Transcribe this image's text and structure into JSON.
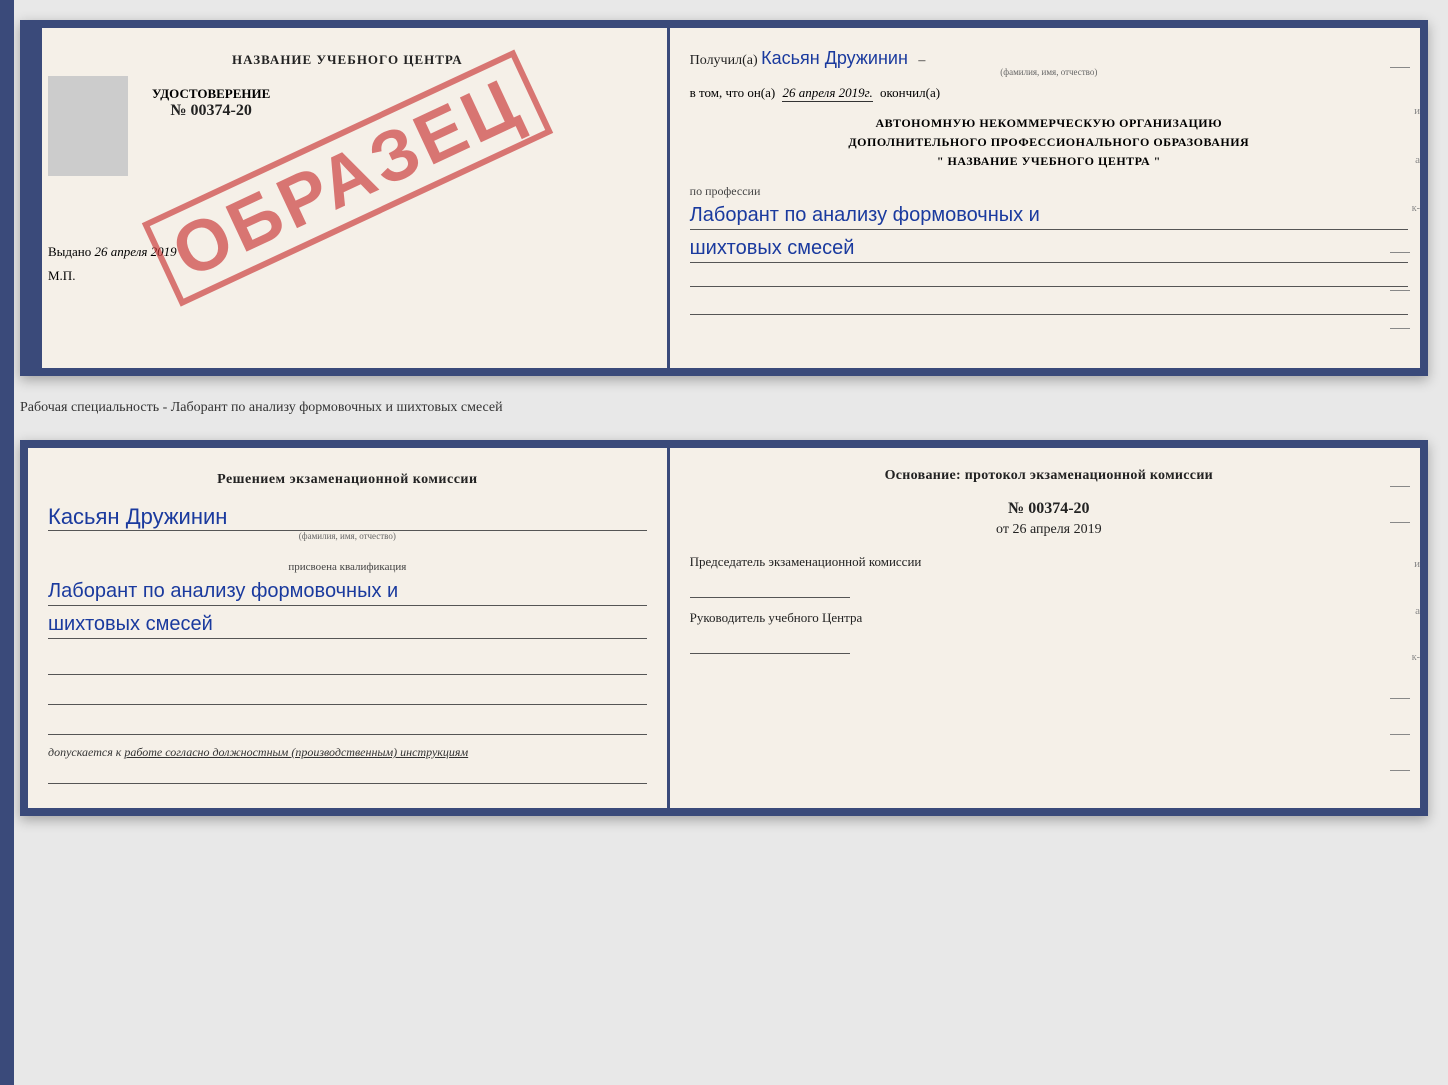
{
  "upper_cert": {
    "left": {
      "title": "НАЗВАНИЕ УЧЕБНОГО ЦЕНТРА",
      "doc_label": "УДОСТОВЕРЕНИЕ",
      "doc_number": "№ 00374-20",
      "vydano_label": "Выдано",
      "vydano_date": "26 апреля 2019",
      "mp_label": "М.П.",
      "obrazec": "ОБРАЗЕЦ"
    },
    "right": {
      "poluchil_prefix": "Получил(а)",
      "recipient_name": "Касьян Дружинин",
      "fio_subtitle": "(фамилия, имя, отчество)",
      "vtom_prefix": "в том, что он(а)",
      "completion_date": "26 апреля 2019г.",
      "okonchil": "окончил(а)",
      "org_line1": "АВТОНОМНУЮ НЕКОММЕРЧЕСКУЮ ОРГАНИЗАЦИЮ",
      "org_line2": "ДОПОЛНИТЕЛЬНОГО ПРОФЕССИОНАЛЬНОГО ОБРАЗОВАНИЯ",
      "org_line3": "\"  НАЗВАНИЕ УЧЕБНОГО ЦЕНТРА  \"",
      "prof_label": "по профессии",
      "prof_name_line1": "Лаборант по анализу формовочных и",
      "prof_name_line2": "шихтовых смесей"
    }
  },
  "subtitle": {
    "text": "Рабочая специальность - Лаборант по анализу формовочных и шихтовых смесей"
  },
  "lower_cert": {
    "left": {
      "resheniem_label": "Решением экзаменационной комиссии",
      "name_handwritten": "Касьян Дружинин",
      "fio_subtitle": "(фамилия, имя, отчество)",
      "prisvoena_label": "присвоена квалификация",
      "kvalif_line1": "Лаборант по анализу формовочных и",
      "kvalif_line2": "шихтовых смесей",
      "dopuskaetsya_prefix": "допускается к",
      "dopuskaetsya_text": "работе согласно должностным (производственным) инструкциям"
    },
    "right": {
      "osnovanie_label": "Основание: протокол экзаменационной комиссии",
      "number_label": "№ 00374-20",
      "ot_label": "от",
      "ot_date": "26 апреля 2019",
      "predsedatel_label": "Председатель экзаменационной комиссии",
      "rukovoditel_label": "Руководитель учебного Центра"
    }
  }
}
